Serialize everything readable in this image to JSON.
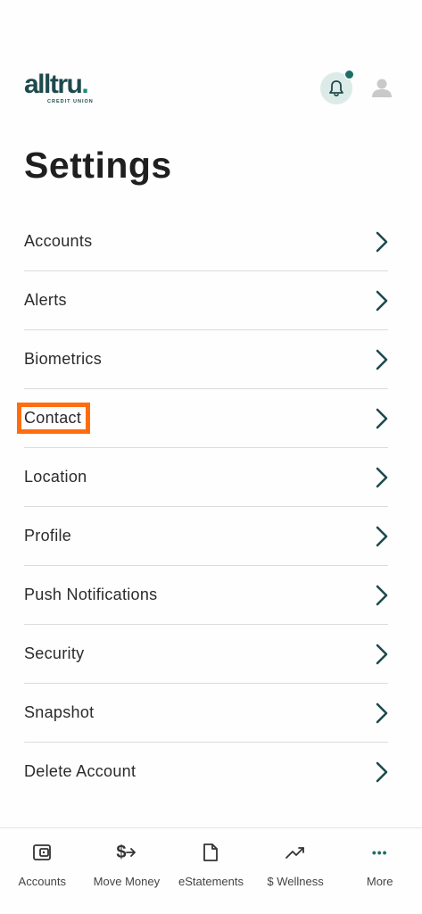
{
  "header": {
    "logo_word": "alltru",
    "logo_dot": ".",
    "logo_sub": "CREDIT UNION",
    "icons": [
      "bell-icon",
      "user-icon"
    ],
    "notification_dot_color": "#1c6f67"
  },
  "page": {
    "title": "Settings"
  },
  "settings": {
    "items": [
      {
        "label": "Accounts"
      },
      {
        "label": "Alerts"
      },
      {
        "label": "Biometrics"
      },
      {
        "label": "Contact"
      },
      {
        "label": "Location"
      },
      {
        "label": "Profile"
      },
      {
        "label": "Push Notifications"
      },
      {
        "label": "Security"
      },
      {
        "label": "Snapshot"
      },
      {
        "label": "Delete Account"
      }
    ],
    "highlighted_item": "Contact",
    "highlight_color": "#ff6d0f"
  },
  "tabbar": {
    "tabs": [
      {
        "label": "Accounts",
        "icon": "wallet-icon"
      },
      {
        "label": "Move Money",
        "icon": "transfer-icon",
        "icon_text": "$"
      },
      {
        "label": "eStatements",
        "icon": "document-icon"
      },
      {
        "label": "$ Wellness",
        "icon": "trend-icon"
      },
      {
        "label": "More",
        "icon": "more-icon",
        "icon_text": "•••"
      }
    ]
  },
  "colors": {
    "brand": "#1e4a4c",
    "accent": "#1c6f67"
  }
}
